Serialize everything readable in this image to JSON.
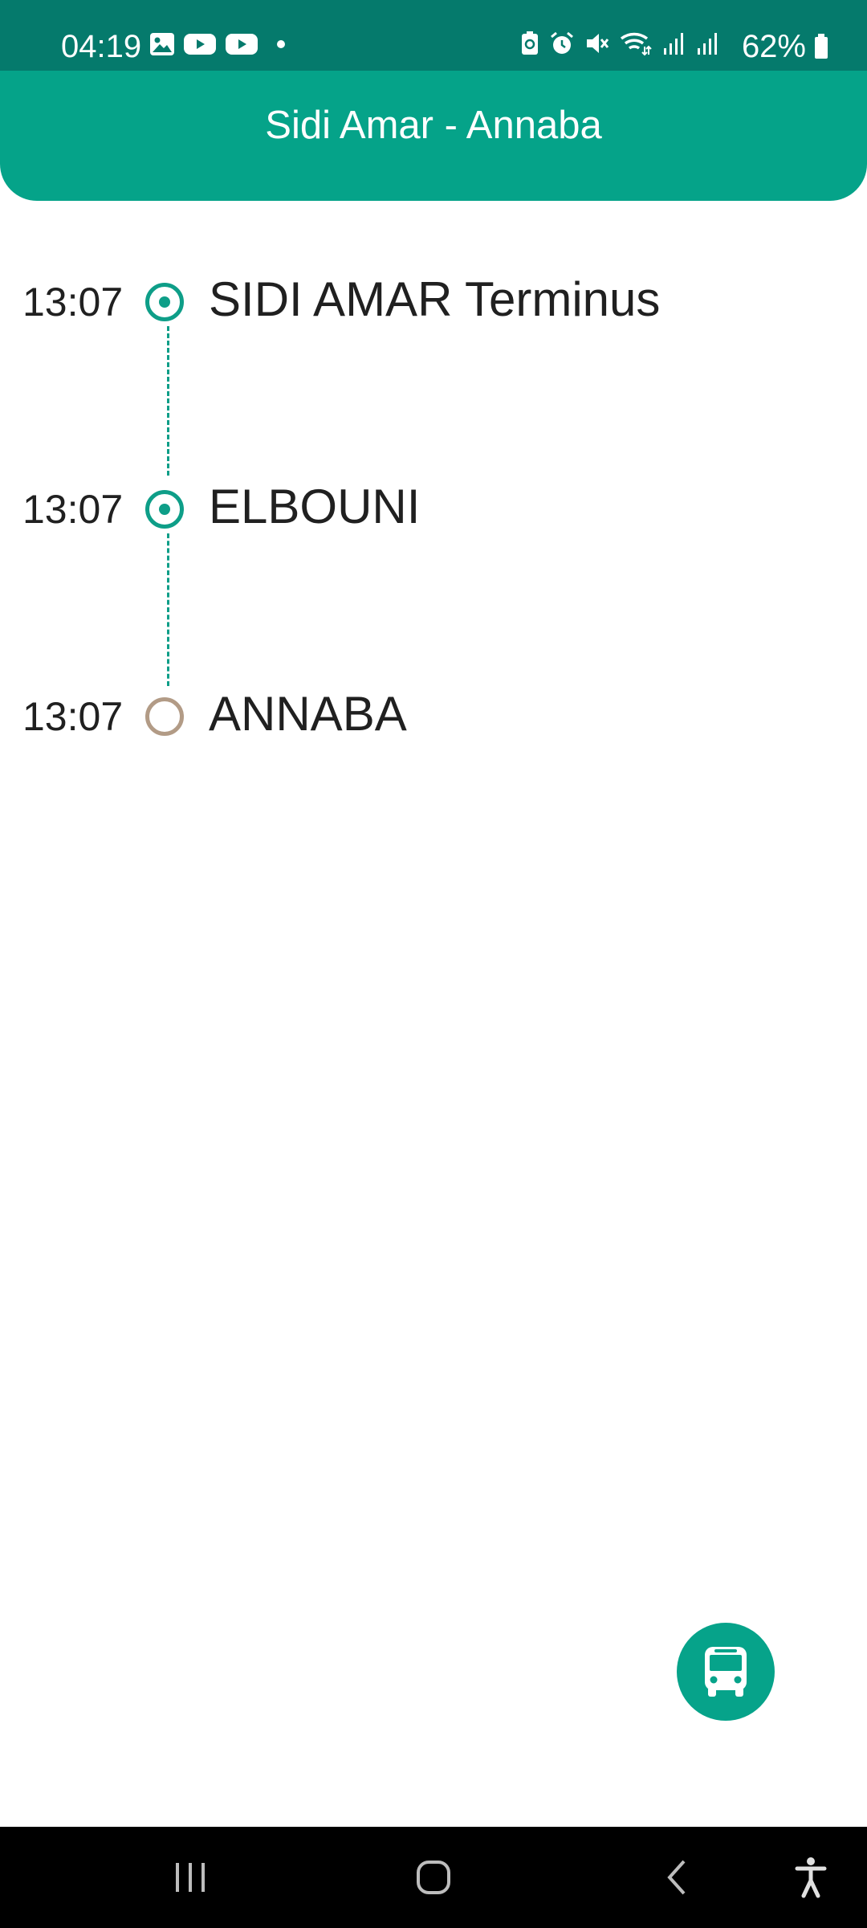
{
  "status_bar": {
    "time": "04:19",
    "battery": "62%",
    "left_icons": [
      "gallery-icon",
      "youtube-icon",
      "youtube-icon",
      "dot-icon"
    ],
    "right_icons": [
      "battery-saver-icon",
      "alarm-icon",
      "mute-icon",
      "wifi-icon",
      "signal-icon",
      "signal-icon"
    ]
  },
  "header": {
    "title": "Sidi Amar - Annaba"
  },
  "timeline": {
    "stops": [
      {
        "time": "13:07",
        "name": "SIDI AMAR Terminus",
        "status": "passed"
      },
      {
        "time": "13:07",
        "name": "ELBOUNI",
        "status": "passed"
      },
      {
        "time": "13:07",
        "name": "ANNABA",
        "status": "upcoming"
      }
    ]
  },
  "fab": {
    "icon": "bus-icon"
  },
  "nav_bar": {
    "buttons": [
      "recent-apps-icon",
      "home-icon",
      "back-icon",
      "accessibility-icon"
    ]
  },
  "colors": {
    "status_bar": "#057a6c",
    "header": "#05a389",
    "accent": "#0e9e88",
    "pending_marker": "#b29b86"
  }
}
